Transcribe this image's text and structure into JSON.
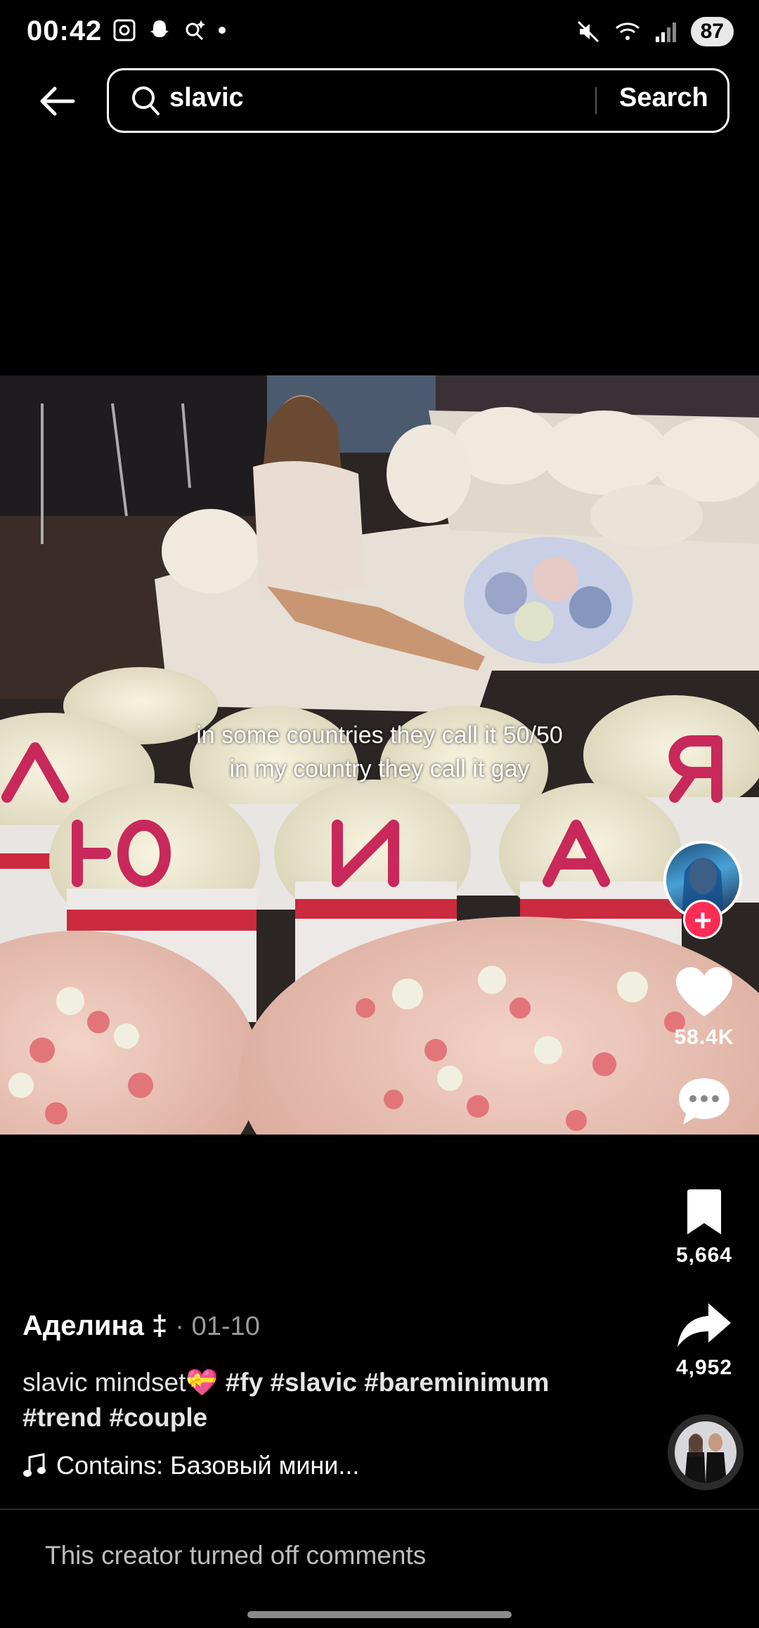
{
  "status": {
    "time": "00:42",
    "battery": "87"
  },
  "search": {
    "query": "slavic",
    "button_label": "Search"
  },
  "video": {
    "overlay_line1": "in some countries they call it 50/50",
    "overlay_line2": "in my country they call it gay"
  },
  "actions": {
    "likes": "58.4K",
    "saves": "5,664",
    "shares": "4,952"
  },
  "post": {
    "author": "Аделина ‡",
    "date": "· 01-10",
    "description_text": "slavic mindset💝 ",
    "hashtags_line1": "#fy #slavic #bareminimum",
    "hashtags_line2": "#trend #couple",
    "sound": "Contains: Базовый мини..."
  },
  "comments": {
    "notice": "This creator turned off comments"
  },
  "colors": {
    "accent_follow": "#fe2c55",
    "background": "#000000"
  },
  "icons": [
    "back-arrow-icon",
    "search-icon",
    "heart-icon",
    "comment-icon",
    "bookmark-icon",
    "share-icon",
    "music-note-icon"
  ]
}
